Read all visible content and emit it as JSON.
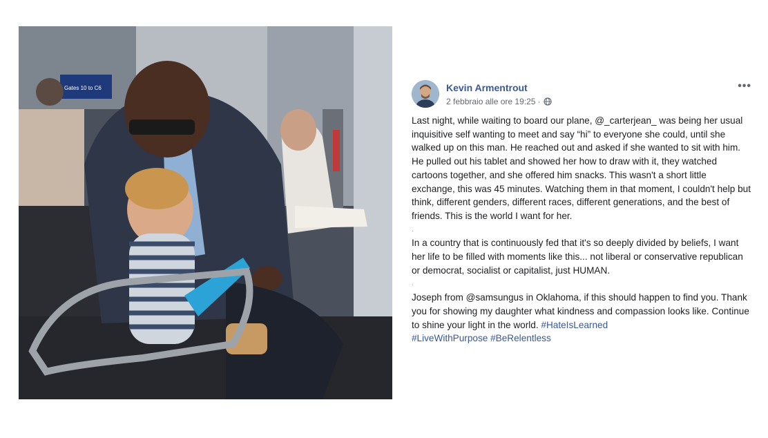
{
  "post": {
    "author": "Kevin Armentrout",
    "timestamp": "2 febbraio alle ore 19:25",
    "separator": "·",
    "privacy_icon": "globe-icon",
    "more_label": "•••",
    "paragraphs": [
      "Last night, while waiting to board our plane, @_carterjean_ was being her usual inquisitive self wanting to meet and say “hi” to everyone she could, until she walked up on this man. He reached out and asked if she wanted to sit with him. He pulled out his tablet and showed her how to draw with it, they watched cartoons together, and she offered him snacks. This wasn't a short little exchange, this was 45 minutes. Watching them in that moment, I couldn't help but think, different genders, different races, different generations, and the best of friends. This is the world I want for her.",
      "In a country that is continuously fed that it's so deeply divided by beliefs, I want her life to be filled with moments like this... not liberal or conservative republican or democrat, socialist or capitalist, just HUMAN.",
      "Joseph from @samsungus in Oklahoma, if this should happen to find you. Thank you for showing my daughter what kindness and compassion looks like. Continue to shine your light in the world."
    ],
    "dot_separator": ".",
    "hashtags": [
      "#HateIsLearned",
      "#LiveWithPurpose",
      "#BeRelentless"
    ],
    "photo_signs": {
      "gate_sign": "Gates 10 to C6"
    }
  },
  "colors": {
    "link": "#385898",
    "meta": "#616770",
    "text": "#1c1e21"
  }
}
